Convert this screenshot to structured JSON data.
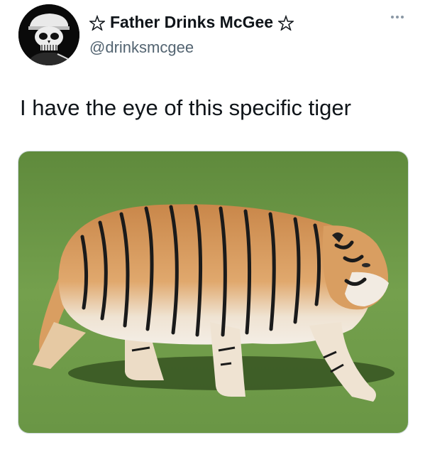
{
  "tweet": {
    "display_name": "Father Drinks McGee",
    "name_symbol_left": "pentagram-icon",
    "name_symbol_right": "pentagram-icon",
    "handle": "@drinksmcgee",
    "text": "I have the eye of this specific tiger",
    "more_icon": "ellipsis-icon"
  },
  "media": {
    "subject": "tiger-photo"
  },
  "colors": {
    "text_primary": "#0f1419",
    "text_secondary": "#536471",
    "grass": "#6f9a4a",
    "tiger_orange": "#d79a5e"
  }
}
